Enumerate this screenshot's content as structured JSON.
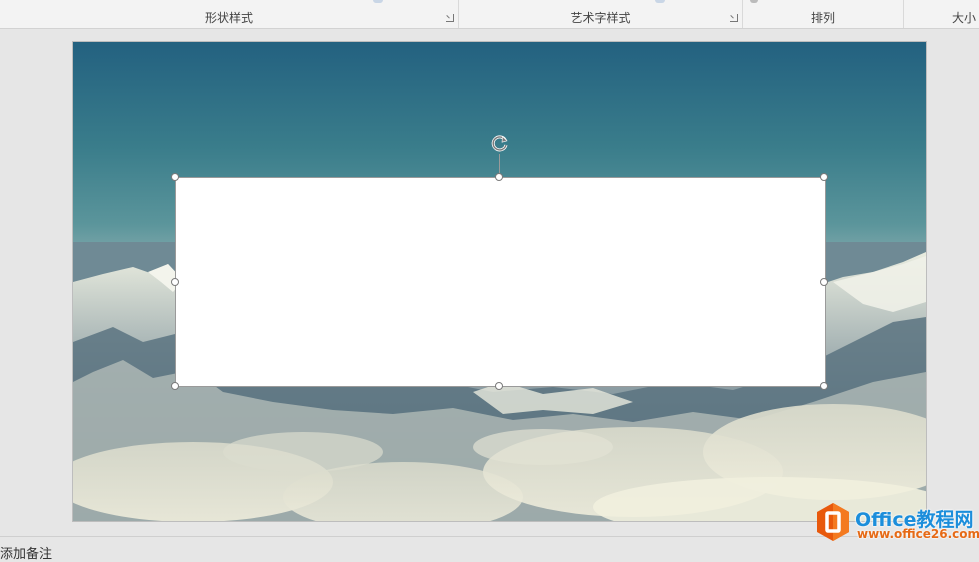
{
  "ribbon": {
    "groups": [
      {
        "label": "形状样式",
        "has_launcher": true
      },
      {
        "label": "艺术字样式",
        "has_launcher": true
      },
      {
        "label": "排列",
        "has_launcher": false
      },
      {
        "label": "大小",
        "has_launcher": false
      }
    ]
  },
  "notes": {
    "label": "添加备注"
  },
  "watermark": {
    "title": "Office教程网",
    "url": "www.office26.com",
    "logo_icon": "office-logo-icon"
  },
  "colors": {
    "ribbon_bg": "#f3f3f3",
    "workspace_bg": "#e6e6e6",
    "shape_fill": "#ffffff",
    "watermark_blue": "#1c8edb",
    "watermark_orange": "#e66a16"
  }
}
